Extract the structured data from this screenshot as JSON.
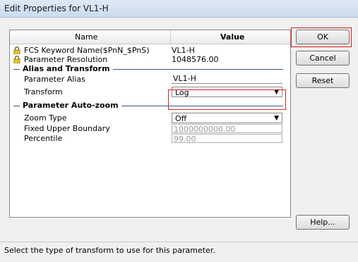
{
  "window": {
    "title": "Edit Properties for VL1-H"
  },
  "grid": {
    "header": {
      "name": "Name",
      "value": "Value"
    },
    "locked_rows": [
      {
        "name": "FCS Keyword Name($PnN_$PnS)",
        "value": "VL1-H"
      },
      {
        "name": "Parameter Resolution",
        "value": "1048576.00"
      }
    ],
    "sections": {
      "alias": "Alias and Transform",
      "autozoom": "Parameter Auto-zoom"
    },
    "alias_rows": {
      "alias_label": "Parameter Alias",
      "alias_value": "VL1-H",
      "transform_label": "Transform",
      "transform_value": "Log"
    },
    "zoom_rows": {
      "zoom_type_label": "Zoom Type",
      "zoom_type_value": "Off",
      "upper_label": "Fixed Upper Boundary",
      "upper_value": "1000000000.00",
      "percentile_label": "Percentile",
      "percentile_value": "99.00"
    }
  },
  "buttons": {
    "ok": "OK",
    "cancel": "Cancel",
    "reset": "Reset",
    "help": "Help..."
  },
  "status": "Select the type of transform to use for this parameter.",
  "colors": {
    "highlight": "#d62020",
    "section_line": "#3a5a8c"
  }
}
